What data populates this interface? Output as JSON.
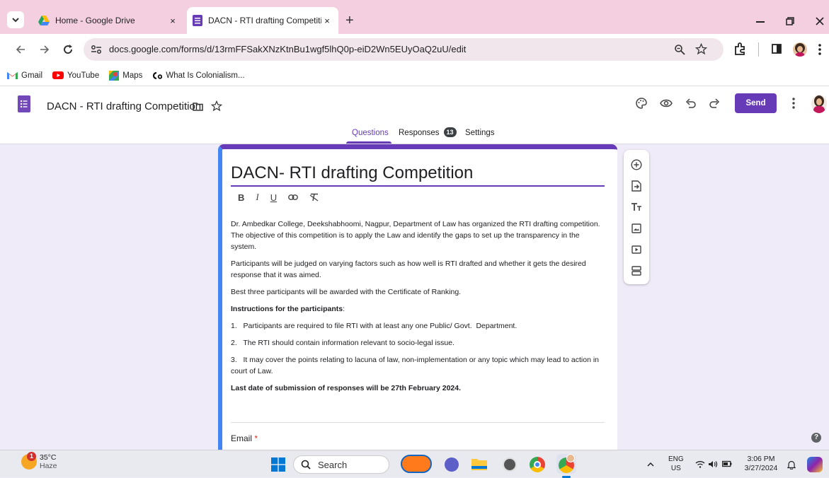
{
  "browser": {
    "tabs": [
      {
        "title": "Home - Google Drive",
        "close": "×"
      },
      {
        "title": "DACN - RTI drafting Competitio",
        "close": "×"
      }
    ],
    "new_tab": "+",
    "url": "docs.google.com/forms/d/13rmFFSakXNzKtnBu1wgf5lhQ0p-eiD2Wn5EUyOaQ2uU/edit",
    "bookmarks": [
      "Gmail",
      "YouTube",
      "Maps",
      "What Is Colonialism..."
    ]
  },
  "forms_header": {
    "title": "DACN - RTI drafting Competition",
    "tabs": {
      "questions": "Questions",
      "responses": "Responses",
      "responses_count": "13",
      "settings": "Settings"
    },
    "send_label": "Send"
  },
  "form": {
    "title": "DACN- RTI drafting Competition",
    "format_buttons": [
      "B",
      "I",
      "U"
    ],
    "paragraphs": [
      "Dr. Ambedkar College, Deekshabhoomi, Nagpur, Department of Law has organized the RTI drafting competition. The objective of this competition is to apply the Law and identify the gaps to set up the transparency in the system.",
      "Participants will be judged on varying factors such as how well is RTI drafted and whether it gets the desired response that it was aimed.",
      "Best three participants will be awarded with the Certificate of Ranking."
    ],
    "instructions_heading": "Instructions for the participants",
    "instructions_colon": ":",
    "instructions": [
      "1.   Participants are required to file RTI with at least any one Public/ Govt.  Department.",
      "2.   The RTI should contain information relevant to socio-legal issue.",
      "3.   It may cover the points relating to lacuna of law, non-implementation or any topic which may lead to action in court of Law."
    ],
    "deadline": "Last date of submission of responses will be 27th February 2024.",
    "first_question": "Email",
    "required_mark": "*"
  },
  "taskbar": {
    "weather_temp": "35°C",
    "weather_desc": "Haze",
    "weather_badge": "1",
    "search_label": "Search",
    "lang": "ENG",
    "region": "US",
    "time": "3:06 PM",
    "date": "3/27/2024"
  },
  "colors": {
    "accent": "#673ab7",
    "tabbar": "#f4cfe0",
    "background": "#f0ebf8"
  }
}
